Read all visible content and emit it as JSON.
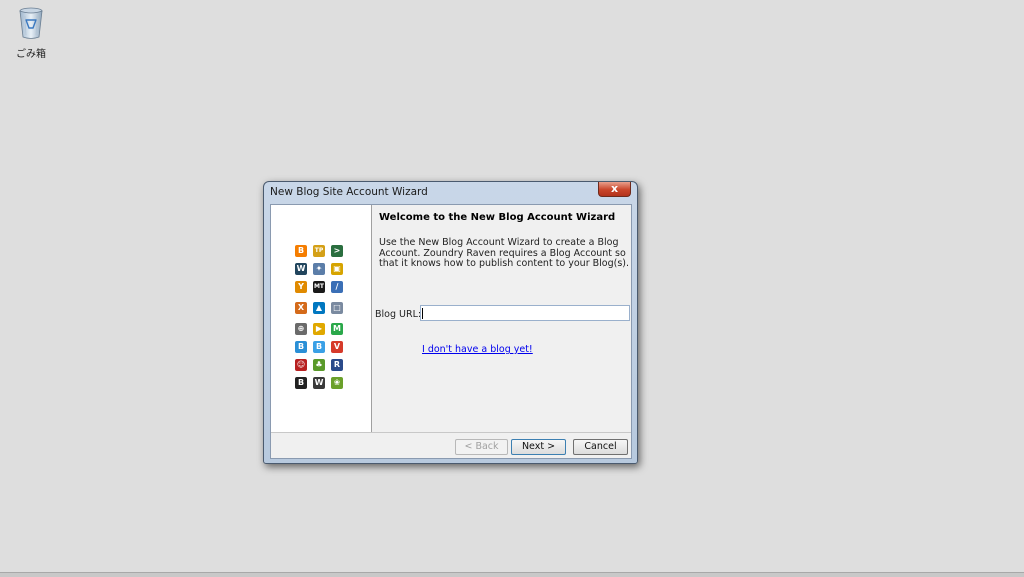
{
  "desktop": {
    "recycle_bin_label": "ごみ箱"
  },
  "window": {
    "title": "New Blog Site Account Wizard",
    "close_symbol": "x"
  },
  "sidebar": {
    "service_icons": [
      {
        "name": "blogger-icon",
        "color": "#f57d00",
        "glyph": "B"
      },
      {
        "name": "typepad-icon",
        "color": "#d4a017",
        "glyph": "TP"
      },
      {
        "name": "livejournal-icon",
        "color": "#2a6e3f",
        "glyph": ">"
      },
      {
        "name": "wordpress-w-icon",
        "color": "#21455d",
        "glyph": "W"
      },
      {
        "name": "tool-icon",
        "color": "#5b7da8",
        "glyph": "✦"
      },
      {
        "name": "squarespace-icon",
        "color": "#d6a400",
        "glyph": "▣"
      },
      {
        "name": "y-service-icon",
        "color": "#e08a00",
        "glyph": "Y"
      },
      {
        "name": "movable-type-icon",
        "color": "#1a1a1a",
        "glyph": "MT"
      },
      {
        "name": "paperclip-icon",
        "color": "#3b6fb6",
        "glyph": "∕"
      },
      {
        "name": "x-service-icon",
        "color": "#d46a1a",
        "glyph": "X"
      },
      {
        "name": "drupal-icon",
        "color": "#0077c0",
        "glyph": "▲"
      },
      {
        "name": "square-service-icon",
        "color": "#7a8aa0",
        "glyph": "□"
      },
      {
        "name": "crosshair-icon",
        "color": "#6a6a6a",
        "glyph": "⊕"
      },
      {
        "name": "walker-icon",
        "color": "#e0a800",
        "glyph": "▶"
      },
      {
        "name": "m-service-icon",
        "color": "#2aa84a",
        "glyph": "M"
      },
      {
        "name": "blue-b-icon",
        "color": "#2a8fd6",
        "glyph": "B"
      },
      {
        "name": "blue-b2-icon",
        "color": "#3aa0e6",
        "glyph": "B"
      },
      {
        "name": "vox-icon",
        "color": "#d63a2a",
        "glyph": "V"
      },
      {
        "name": "red-face-icon",
        "color": "#b82020",
        "glyph": "☺"
      },
      {
        "name": "tree-icon",
        "color": "#5a9a2a",
        "glyph": "♣"
      },
      {
        "name": "r-service-icon",
        "color": "#2a4a8a",
        "glyph": "R"
      },
      {
        "name": "b-dark-icon",
        "color": "#222222",
        "glyph": "B"
      },
      {
        "name": "wordpress-icon",
        "color": "#3a3a3a",
        "glyph": "W"
      },
      {
        "name": "green-spiral-icon",
        "color": "#6aa02a",
        "glyph": "❀"
      }
    ]
  },
  "content": {
    "heading": "Welcome to the New Blog Account Wizard",
    "description": "Use the New Blog Account Wizard to create a Blog Account.  Zoundry Raven requires a Blog Account so that it knows how to publish content to your Blog(s).",
    "url_label": "Blog URL:",
    "url_value": "",
    "no_blog_link": "I don't have a blog yet!"
  },
  "buttons": {
    "back": "< Back",
    "next": "Next >",
    "cancel": "Cancel"
  }
}
